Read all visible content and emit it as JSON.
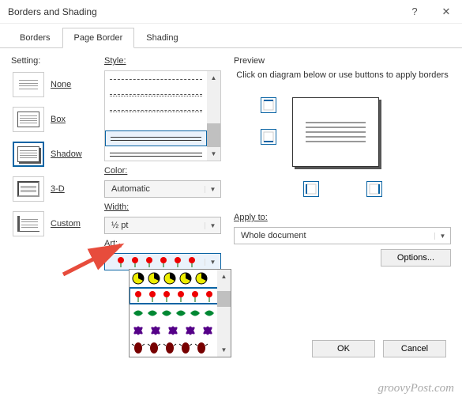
{
  "window": {
    "title": "Borders and Shading"
  },
  "tabs": {
    "borders": "Borders",
    "page_border": "Page Border",
    "shading": "Shading"
  },
  "setting": {
    "label": "Setting:",
    "items": [
      {
        "label": "None"
      },
      {
        "label": "Box"
      },
      {
        "label": "Shadow"
      },
      {
        "label": "3-D"
      },
      {
        "label": "Custom"
      }
    ]
  },
  "style": {
    "label": "Style:",
    "color_label": "Color:",
    "color_value": "Automatic",
    "width_label": "Width:",
    "width_value": "½ pt",
    "art_label": "Art:",
    "art_value": ""
  },
  "preview": {
    "label": "Preview",
    "instruction": "Click on diagram below or use buttons to apply borders"
  },
  "apply": {
    "label": "Apply to:",
    "value": "Whole document"
  },
  "buttons": {
    "options": "Options...",
    "ok": "OK",
    "cancel": "Cancel"
  },
  "watermark": "groovyPost.com"
}
